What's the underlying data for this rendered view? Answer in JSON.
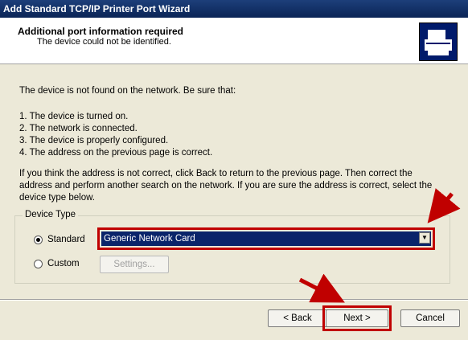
{
  "window": {
    "title": "Add Standard TCP/IP Printer Port Wizard"
  },
  "header": {
    "title": "Additional port information required",
    "subtitle": "The device could not be identified."
  },
  "body": {
    "intro": "The device is not found on the network.  Be sure that:",
    "checklist": [
      "1.  The device is turned on.",
      "2.  The network is connected.",
      "3.  The device is properly configured.",
      "4.  The address on the previous page is correct."
    ],
    "instructions_lines": [
      "If you think the address is not correct, click Back to return to the previous page.  Then correct the",
      "address and perform another search on the network.  If you are sure the address is correct, select the",
      "device type below."
    ]
  },
  "device_type": {
    "legend": "Device Type",
    "standard_label": "Standard",
    "custom_label": "Custom",
    "selected_device": "Generic Network Card",
    "settings_label": "Settings..."
  },
  "footer": {
    "back_label": "< Back",
    "next_label": "Next >",
    "cancel_label": "Cancel"
  },
  "colors": {
    "highlight": "#c00000",
    "selection": "#0a246a"
  }
}
